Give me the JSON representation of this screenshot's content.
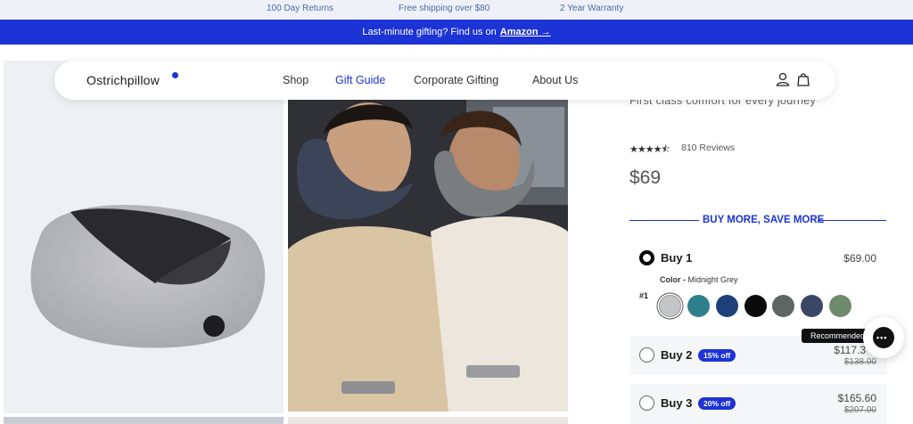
{
  "topbar": {
    "items": [
      "100 Day Returns",
      "Free shipping over $80",
      "2 Year Warranty"
    ]
  },
  "promo": {
    "text": "Last-minute gifting? Find us on",
    "link": "Amazon →"
  },
  "nav": {
    "logo": "Ostrichpillow",
    "links": [
      "Shop",
      "Gift Guide",
      "Corporate Gifting",
      "About Us"
    ],
    "active_link": "Gift Guide",
    "icons": [
      "account-icon",
      "bag-icon"
    ]
  },
  "product": {
    "tagline": "First class comfort for every journey",
    "rating_stars": "★★★★⯪",
    "reviews": "810 Reviews",
    "price": "$69"
  },
  "bundle": {
    "heading": "BUY MORE, SAVE MORE",
    "options": [
      {
        "title": "Buy 1",
        "price": "$69.00",
        "selected": true
      },
      {
        "title": "Buy 2",
        "badge": "15% off",
        "price": "$117.3",
        "was": "$138.00",
        "selected": false
      },
      {
        "title": "Buy 3",
        "badge": "20% off",
        "price": "$165.60",
        "was": "$207.00",
        "selected": false
      }
    ],
    "color_label": "Color -",
    "color_value": "Midnight Grey",
    "item_number": "#1",
    "swatches": [
      {
        "name": "light-grey",
        "color": "#c4c5c7",
        "selected": true
      },
      {
        "name": "teal",
        "color": "#2e7f8c"
      },
      {
        "name": "navy",
        "color": "#1f3f7a"
      },
      {
        "name": "black",
        "color": "#0a0a0a"
      },
      {
        "name": "dark-grey",
        "color": "#5f6563"
      },
      {
        "name": "slate-blue",
        "color": "#3a4764"
      },
      {
        "name": "sage",
        "color": "#6f8a6c"
      }
    ]
  },
  "recommended_tag": "Recommended",
  "chat": {
    "icon": "chat-icon"
  },
  "colors": {
    "accent": "#1c33d6",
    "topbar_bg": "#eef2f8"
  }
}
